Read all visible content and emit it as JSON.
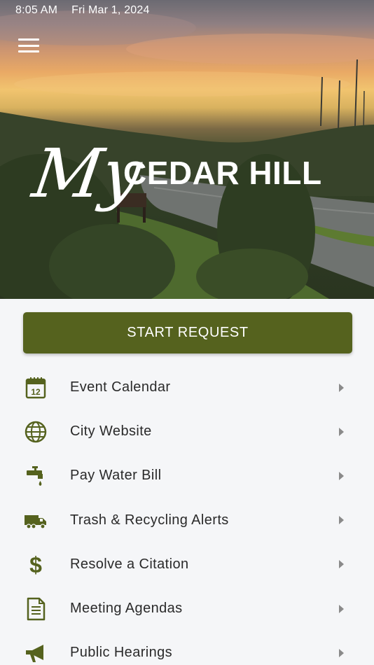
{
  "status_bar": {
    "time": "8:05 AM",
    "date": "Fri Mar 1, 2024"
  },
  "header": {
    "logo_script": "My",
    "logo_city": "CEDAR HILL"
  },
  "primary_action": {
    "label": "START REQUEST"
  },
  "menu": [
    {
      "label": "Event Calendar",
      "icon": "calendar-icon"
    },
    {
      "label": "City Website",
      "icon": "globe-icon"
    },
    {
      "label": "Pay Water Bill",
      "icon": "faucet-icon"
    },
    {
      "label": "Trash & Recycling Alerts",
      "icon": "truck-icon"
    },
    {
      "label": "Resolve a Citation",
      "icon": "dollar-icon"
    },
    {
      "label": "Meeting Agendas",
      "icon": "document-icon"
    },
    {
      "label": "Public Hearings",
      "icon": "megaphone-icon"
    }
  ],
  "colors": {
    "accent": "#55621e",
    "background": "#f5f6f8",
    "text": "#2a2a2a",
    "chevron": "#8a8a8a"
  }
}
